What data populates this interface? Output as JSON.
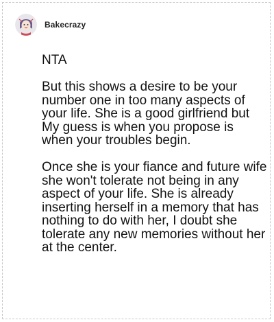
{
  "post": {
    "username": "Bakecrazy",
    "avatar_icon": "cartoon-avatar-icon",
    "paragraphs": [
      "NTA",
      "But this shows a desire to be your number one in too many aspects of your life. She is a good girlfriend but My guess is when you propose is when your troubles begin.",
      "Once she is your fiance and future wife she won't tolerate not being in any aspect of your life. She is already inserting herself in a memory that has nothing to do with her, I doubt she tolerate any new memories without her at the center."
    ]
  },
  "colors": {
    "text": "#111111",
    "border": "#c8c8c8",
    "background": "#ffffff"
  }
}
